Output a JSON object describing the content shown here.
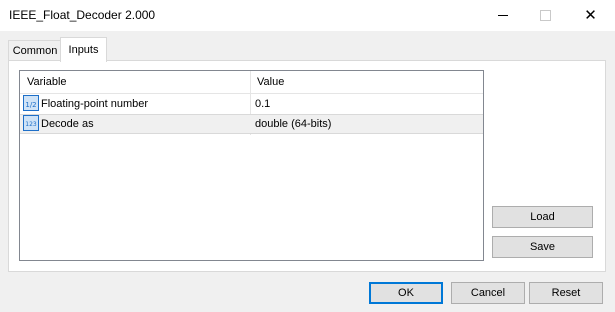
{
  "window": {
    "title": "IEEE_Float_Decoder 2.000"
  },
  "tabs": [
    {
      "label": "Common",
      "selected": false
    },
    {
      "label": "Inputs",
      "selected": true
    }
  ],
  "grid": {
    "columns": [
      "Variable",
      "Value"
    ],
    "rows": [
      {
        "icon": "fraction-parameter-icon",
        "icon_text": "1/2",
        "variable": "Floating-point number",
        "value": "0.1"
      },
      {
        "icon": "numeric-parameter-icon",
        "icon_text": "123",
        "variable": "Decode as",
        "value": "double (64-bits)"
      }
    ]
  },
  "side_buttons": {
    "load": "Load",
    "save": "Save"
  },
  "dialog_buttons": {
    "ok": "OK",
    "cancel": "Cancel",
    "reset": "Reset"
  },
  "colors": {
    "accent": "#0078d7",
    "selected_row": "#f0f0f0",
    "icon_blue": "#1e6fc8"
  }
}
